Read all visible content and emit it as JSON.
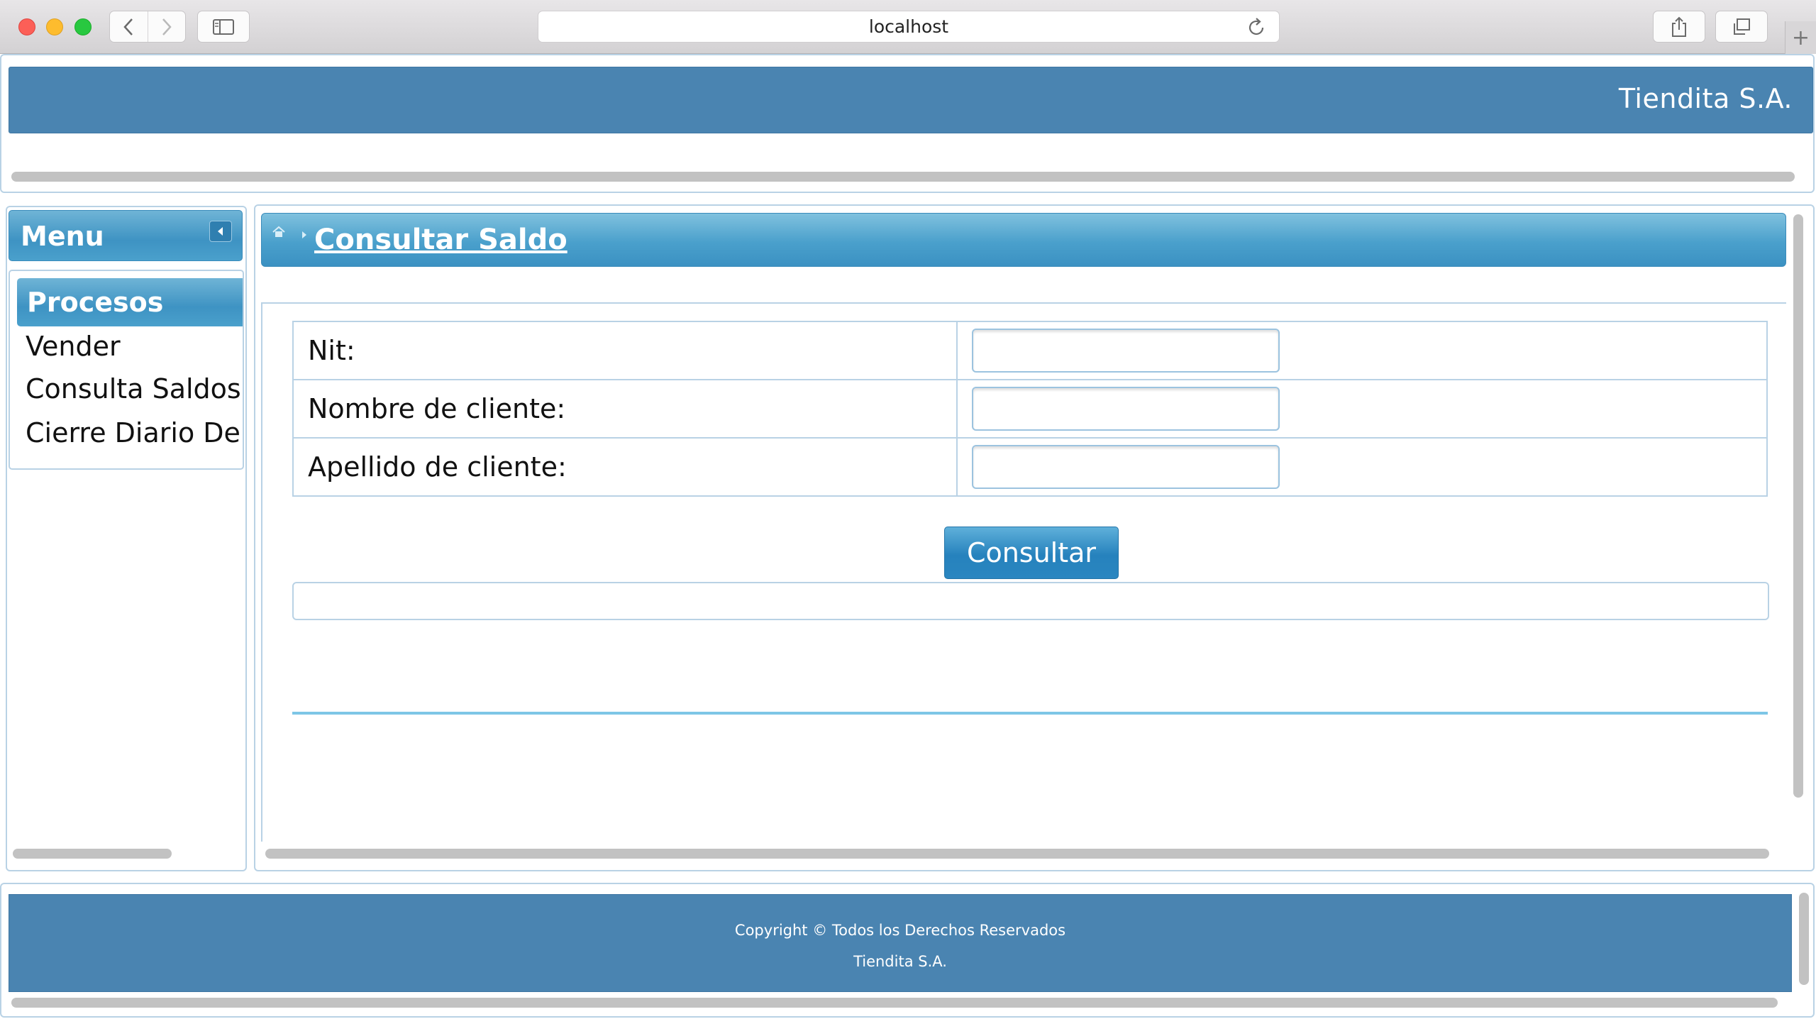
{
  "browser": {
    "url": "localhost"
  },
  "header": {
    "company": "Tiendita S.A."
  },
  "menu": {
    "title": "Menu",
    "section": "Procesos",
    "items": [
      "Vender",
      "Consulta Saldos",
      "Cierre Diario De Caja"
    ]
  },
  "page": {
    "title": "Consultar Saldo"
  },
  "form": {
    "nit_label": "Nit:",
    "nit_value": "",
    "nombre_label": "Nombre de cliente:",
    "nombre_value": "",
    "apellido_label": "Apellido de cliente:",
    "apellido_value": "",
    "submit_label": "Consultar"
  },
  "footer": {
    "copyright": "Copyright © Todos los Derechos Reservados",
    "company": "Tiendita S.A."
  },
  "colors": {
    "header_blue": "#4a84b1",
    "accent_blue": "#3e93c3",
    "border_blue": "#b9d2e5"
  }
}
